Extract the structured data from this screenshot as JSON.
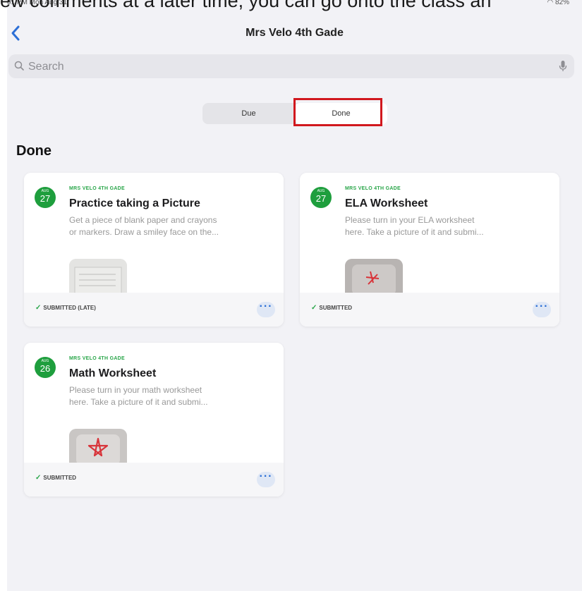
{
  "caption_overlay": "ew comments at a later time, you can go onto the class an",
  "status_bar": {
    "time": "01 PM  Mon Aug 31",
    "battery": "82%"
  },
  "nav": {
    "title": "Mrs Velo 4th Gade"
  },
  "search": {
    "placeholder": "Search"
  },
  "segments": {
    "due": "Due",
    "done": "Done",
    "selected": "Done"
  },
  "section_title": "Done",
  "colors": {
    "accent_green": "#1e9e3d",
    "highlight_red": "#d1181e",
    "link_blue": "#2c6fd6"
  },
  "cards": [
    {
      "month": "AUG",
      "day": "27",
      "class": "MRS VELO 4TH GADE",
      "title": "Practice taking a Picture",
      "desc_line1": "Get a piece of blank paper and crayons",
      "desc_line2": "or markers. Draw a smiley face on the...",
      "status": "SUBMITTED (LATE)",
      "more": "···"
    },
    {
      "month": "AUG",
      "day": "27",
      "class": "MRS VELO 4TH GADE",
      "title": "ELA Worksheet",
      "desc_line1": "Please turn in your ELA worksheet",
      "desc_line2": "here. Take a picture of it and submi...",
      "status": "SUBMITTED",
      "more": "···"
    },
    {
      "month": "AUG",
      "day": "26",
      "class": "MRS VELO 4TH GADE",
      "title": "Math Worksheet",
      "desc_line1": "Please turn in your math worksheet",
      "desc_line2": "here. Take a picture of it and submi...",
      "status": "SUBMITTED",
      "more": "···"
    }
  ]
}
